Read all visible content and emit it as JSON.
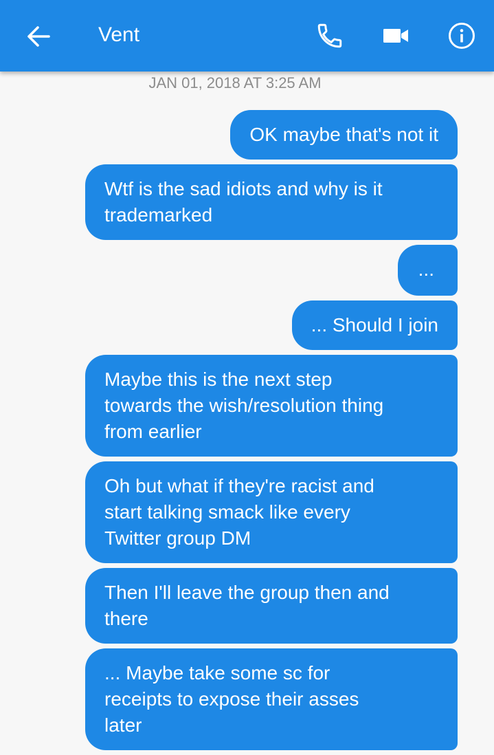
{
  "header": {
    "title": "Vent",
    "icons": {
      "back": "arrow-left-icon",
      "call": "phone-icon",
      "video": "video-camera-icon",
      "info": "info-icon"
    },
    "background_color": "#1e88e5"
  },
  "thread": {
    "timestamp": "JAN 01, 2018 AT 3:25 AM",
    "bubble_color": "#1e88e5",
    "messages": [
      {
        "text": "OK maybe that's not it"
      },
      {
        "text": "Wtf is the sad idiots and why is it\ntrademarked"
      },
      {
        "text": "..."
      },
      {
        "text": "... Should I join"
      },
      {
        "text": "Maybe this is the next step\ntowards the wish/resolution thing\nfrom earlier"
      },
      {
        "text": "Oh but what if they're racist and\nstart talking smack like every\nTwitter group DM"
      },
      {
        "text": "Then I'll leave the group then and\nthere"
      },
      {
        "text": "... Maybe take some sc for\nreceipts to expose their asses\nlater"
      }
    ]
  }
}
